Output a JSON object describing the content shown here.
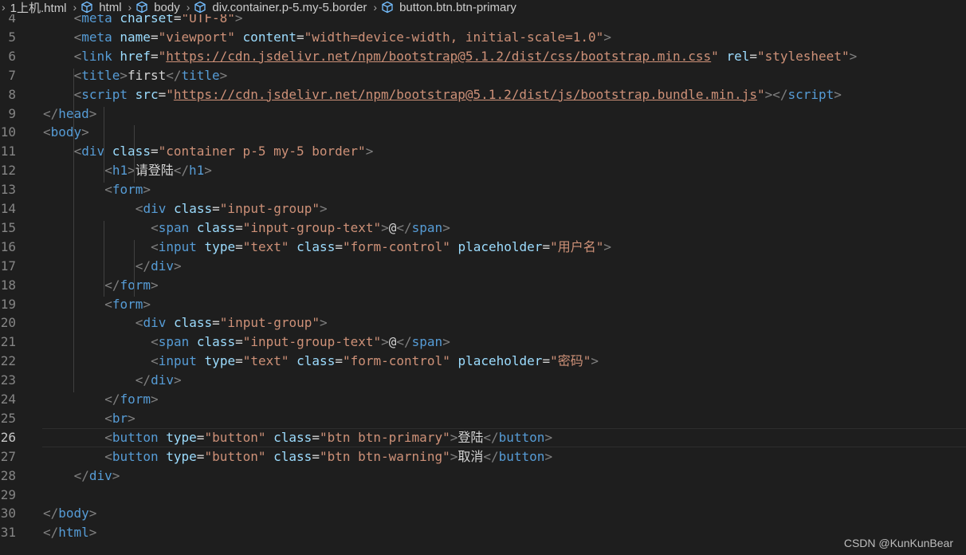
{
  "breadcrumb": {
    "items": [
      {
        "label": "1上机.html",
        "icon": "html-file-icon"
      },
      {
        "label": "html",
        "icon": "cube-icon"
      },
      {
        "label": "body",
        "icon": "cube-icon"
      },
      {
        "label": "div.container.p-5.my-5.border",
        "icon": "cube-icon"
      },
      {
        "label": "button.btn.btn-primary",
        "icon": "cube-icon"
      }
    ]
  },
  "editor": {
    "active_line": 26,
    "colors": {
      "background": "#1e1e1e",
      "tag": "#569cd6",
      "punctuation": "#808080",
      "attribute": "#9cdcfe",
      "string": "#ce9178",
      "text": "#d4d4d4"
    },
    "lines": [
      {
        "num": "4",
        "indent": 1,
        "tokens": [
          {
            "k": "p",
            "v": "<"
          },
          {
            "k": "t",
            "v": "meta"
          },
          {
            "k": "x",
            "v": " "
          },
          {
            "k": "a",
            "v": "charset"
          },
          {
            "k": "x",
            "v": "="
          },
          {
            "k": "s",
            "v": "\"UTF-8\""
          },
          {
            "k": "p",
            "v": ">"
          }
        ]
      },
      {
        "num": "5",
        "indent": 1,
        "tokens": [
          {
            "k": "p",
            "v": "<"
          },
          {
            "k": "t",
            "v": "meta"
          },
          {
            "k": "x",
            "v": " "
          },
          {
            "k": "a",
            "v": "name"
          },
          {
            "k": "x",
            "v": "="
          },
          {
            "k": "s",
            "v": "\"viewport\""
          },
          {
            "k": "x",
            "v": " "
          },
          {
            "k": "a",
            "v": "content"
          },
          {
            "k": "x",
            "v": "="
          },
          {
            "k": "s",
            "v": "\"width=device-width, initial-scale=1.0\""
          },
          {
            "k": "p",
            "v": ">"
          }
        ]
      },
      {
        "num": "6",
        "indent": 1,
        "tokens": [
          {
            "k": "p",
            "v": "<"
          },
          {
            "k": "t",
            "v": "link"
          },
          {
            "k": "x",
            "v": " "
          },
          {
            "k": "a",
            "v": "href"
          },
          {
            "k": "x",
            "v": "="
          },
          {
            "k": "s",
            "v": "\""
          },
          {
            "k": "su",
            "v": "https://cdn.jsdelivr.net/npm/bootstrap@5.1.2/dist/css/bootstrap.min.css"
          },
          {
            "k": "s",
            "v": "\""
          },
          {
            "k": "x",
            "v": " "
          },
          {
            "k": "a",
            "v": "rel"
          },
          {
            "k": "x",
            "v": "="
          },
          {
            "k": "s",
            "v": "\"stylesheet\""
          },
          {
            "k": "p",
            "v": ">"
          }
        ]
      },
      {
        "num": "7",
        "indent": 1,
        "tokens": [
          {
            "k": "p",
            "v": "<"
          },
          {
            "k": "t",
            "v": "title"
          },
          {
            "k": "p",
            "v": ">"
          },
          {
            "k": "x",
            "v": "first"
          },
          {
            "k": "p",
            "v": "</"
          },
          {
            "k": "t",
            "v": "title"
          },
          {
            "k": "p",
            "v": ">"
          }
        ]
      },
      {
        "num": "8",
        "indent": 1,
        "tokens": [
          {
            "k": "p",
            "v": "<"
          },
          {
            "k": "t",
            "v": "script"
          },
          {
            "k": "x",
            "v": " "
          },
          {
            "k": "a",
            "v": "src"
          },
          {
            "k": "x",
            "v": "="
          },
          {
            "k": "s",
            "v": "\""
          },
          {
            "k": "su",
            "v": "https://cdn.jsdelivr.net/npm/bootstrap@5.1.2/dist/js/bootstrap.bundle.min.js"
          },
          {
            "k": "s",
            "v": "\""
          },
          {
            "k": "p",
            "v": "></"
          },
          {
            "k": "t",
            "v": "script"
          },
          {
            "k": "p",
            "v": ">"
          }
        ]
      },
      {
        "num": "9",
        "indent": 0,
        "tokens": [
          {
            "k": "p",
            "v": "</"
          },
          {
            "k": "t",
            "v": "head"
          },
          {
            "k": "p",
            "v": ">"
          }
        ]
      },
      {
        "num": "10",
        "indent": 0,
        "tokens": [
          {
            "k": "p",
            "v": "<"
          },
          {
            "k": "t",
            "v": "body"
          },
          {
            "k": "p",
            "v": ">"
          }
        ]
      },
      {
        "num": "11",
        "indent": 1,
        "tokens": [
          {
            "k": "p",
            "v": "<"
          },
          {
            "k": "t",
            "v": "div"
          },
          {
            "k": "x",
            "v": " "
          },
          {
            "k": "a",
            "v": "class"
          },
          {
            "k": "x",
            "v": "="
          },
          {
            "k": "s",
            "v": "\"container p-5 my-5 border\""
          },
          {
            "k": "p",
            "v": ">"
          }
        ]
      },
      {
        "num": "12",
        "indent": 2,
        "tokens": [
          {
            "k": "p",
            "v": "<"
          },
          {
            "k": "t",
            "v": "h1"
          },
          {
            "k": "p",
            "v": ">"
          },
          {
            "k": "x",
            "v": "请登陆"
          },
          {
            "k": "p",
            "v": "</"
          },
          {
            "k": "t",
            "v": "h1"
          },
          {
            "k": "p",
            "v": ">"
          }
        ]
      },
      {
        "num": "13",
        "indent": 2,
        "tokens": [
          {
            "k": "p",
            "v": "<"
          },
          {
            "k": "t",
            "v": "form"
          },
          {
            "k": "p",
            "v": ">"
          }
        ]
      },
      {
        "num": "14",
        "indent": 3,
        "tokens": [
          {
            "k": "p",
            "v": "<"
          },
          {
            "k": "t",
            "v": "div"
          },
          {
            "k": "x",
            "v": " "
          },
          {
            "k": "a",
            "v": "class"
          },
          {
            "k": "x",
            "v": "="
          },
          {
            "k": "s",
            "v": "\"input-group\""
          },
          {
            "k": "p",
            "v": ">"
          }
        ]
      },
      {
        "num": "15",
        "indent": 3.5,
        "tokens": [
          {
            "k": "p",
            "v": "<"
          },
          {
            "k": "t",
            "v": "span"
          },
          {
            "k": "x",
            "v": " "
          },
          {
            "k": "a",
            "v": "class"
          },
          {
            "k": "x",
            "v": "="
          },
          {
            "k": "s",
            "v": "\"input-group-text\""
          },
          {
            "k": "p",
            "v": ">"
          },
          {
            "k": "x",
            "v": "@"
          },
          {
            "k": "p",
            "v": "</"
          },
          {
            "k": "t",
            "v": "span"
          },
          {
            "k": "p",
            "v": ">"
          }
        ]
      },
      {
        "num": "16",
        "indent": 3.5,
        "tokens": [
          {
            "k": "p",
            "v": "<"
          },
          {
            "k": "t",
            "v": "input"
          },
          {
            "k": "x",
            "v": " "
          },
          {
            "k": "a",
            "v": "type"
          },
          {
            "k": "x",
            "v": "="
          },
          {
            "k": "s",
            "v": "\"text\""
          },
          {
            "k": "x",
            "v": " "
          },
          {
            "k": "a",
            "v": "class"
          },
          {
            "k": "x",
            "v": "="
          },
          {
            "k": "s",
            "v": "\"form-control\""
          },
          {
            "k": "x",
            "v": " "
          },
          {
            "k": "a",
            "v": "placeholder"
          },
          {
            "k": "x",
            "v": "="
          },
          {
            "k": "s",
            "v": "\"用户名\""
          },
          {
            "k": "p",
            "v": ">"
          }
        ]
      },
      {
        "num": "17",
        "indent": 3,
        "tokens": [
          {
            "k": "p",
            "v": "</"
          },
          {
            "k": "t",
            "v": "div"
          },
          {
            "k": "p",
            "v": ">"
          }
        ]
      },
      {
        "num": "18",
        "indent": 2,
        "tokens": [
          {
            "k": "p",
            "v": "</"
          },
          {
            "k": "t",
            "v": "form"
          },
          {
            "k": "p",
            "v": ">"
          }
        ]
      },
      {
        "num": "19",
        "indent": 2,
        "tokens": [
          {
            "k": "p",
            "v": "<"
          },
          {
            "k": "t",
            "v": "form"
          },
          {
            "k": "p",
            "v": ">"
          }
        ]
      },
      {
        "num": "20",
        "indent": 3,
        "tokens": [
          {
            "k": "p",
            "v": "<"
          },
          {
            "k": "t",
            "v": "div"
          },
          {
            "k": "x",
            "v": " "
          },
          {
            "k": "a",
            "v": "class"
          },
          {
            "k": "x",
            "v": "="
          },
          {
            "k": "s",
            "v": "\"input-group\""
          },
          {
            "k": "p",
            "v": ">"
          }
        ]
      },
      {
        "num": "21",
        "indent": 3.5,
        "tokens": [
          {
            "k": "p",
            "v": "<"
          },
          {
            "k": "t",
            "v": "span"
          },
          {
            "k": "x",
            "v": " "
          },
          {
            "k": "a",
            "v": "class"
          },
          {
            "k": "x",
            "v": "="
          },
          {
            "k": "s",
            "v": "\"input-group-text\""
          },
          {
            "k": "p",
            "v": ">"
          },
          {
            "k": "x",
            "v": "@"
          },
          {
            "k": "p",
            "v": "</"
          },
          {
            "k": "t",
            "v": "span"
          },
          {
            "k": "p",
            "v": ">"
          }
        ]
      },
      {
        "num": "22",
        "indent": 3.5,
        "tokens": [
          {
            "k": "p",
            "v": "<"
          },
          {
            "k": "t",
            "v": "input"
          },
          {
            "k": "x",
            "v": " "
          },
          {
            "k": "a",
            "v": "type"
          },
          {
            "k": "x",
            "v": "="
          },
          {
            "k": "s",
            "v": "\"text\""
          },
          {
            "k": "x",
            "v": " "
          },
          {
            "k": "a",
            "v": "class"
          },
          {
            "k": "x",
            "v": "="
          },
          {
            "k": "s",
            "v": "\"form-control\""
          },
          {
            "k": "x",
            "v": " "
          },
          {
            "k": "a",
            "v": "placeholder"
          },
          {
            "k": "x",
            "v": "="
          },
          {
            "k": "s",
            "v": "\"密码\""
          },
          {
            "k": "p",
            "v": ">"
          }
        ]
      },
      {
        "num": "23",
        "indent": 3,
        "tokens": [
          {
            "k": "p",
            "v": "</"
          },
          {
            "k": "t",
            "v": "div"
          },
          {
            "k": "p",
            "v": ">"
          }
        ]
      },
      {
        "num": "24",
        "indent": 2,
        "tokens": [
          {
            "k": "p",
            "v": "</"
          },
          {
            "k": "t",
            "v": "form"
          },
          {
            "k": "p",
            "v": ">"
          }
        ]
      },
      {
        "num": "25",
        "indent": 2,
        "tokens": [
          {
            "k": "p",
            "v": "<"
          },
          {
            "k": "t",
            "v": "br"
          },
          {
            "k": "p",
            "v": ">"
          }
        ]
      },
      {
        "num": "26",
        "indent": 2,
        "tokens": [
          {
            "k": "p",
            "v": "<"
          },
          {
            "k": "t",
            "v": "button"
          },
          {
            "k": "x",
            "v": " "
          },
          {
            "k": "a",
            "v": "type"
          },
          {
            "k": "x",
            "v": "="
          },
          {
            "k": "s",
            "v": "\"button\""
          },
          {
            "k": "x",
            "v": " "
          },
          {
            "k": "a",
            "v": "class"
          },
          {
            "k": "x",
            "v": "="
          },
          {
            "k": "s",
            "v": "\"btn btn-primary\""
          },
          {
            "k": "p",
            "v": ">"
          },
          {
            "k": "x",
            "v": "登陆"
          },
          {
            "k": "p",
            "v": "</"
          },
          {
            "k": "t",
            "v": "button"
          },
          {
            "k": "p",
            "v": ">"
          }
        ]
      },
      {
        "num": "27",
        "indent": 2,
        "tokens": [
          {
            "k": "p",
            "v": "<"
          },
          {
            "k": "t",
            "v": "button"
          },
          {
            "k": "x",
            "v": " "
          },
          {
            "k": "a",
            "v": "type"
          },
          {
            "k": "x",
            "v": "="
          },
          {
            "k": "s",
            "v": "\"button\""
          },
          {
            "k": "x",
            "v": " "
          },
          {
            "k": "a",
            "v": "class"
          },
          {
            "k": "x",
            "v": "="
          },
          {
            "k": "s",
            "v": "\"btn btn-warning\""
          },
          {
            "k": "p",
            "v": ">"
          },
          {
            "k": "x",
            "v": "取消"
          },
          {
            "k": "p",
            "v": "</"
          },
          {
            "k": "t",
            "v": "button"
          },
          {
            "k": "p",
            "v": ">"
          }
        ]
      },
      {
        "num": "28",
        "indent": 1,
        "tokens": [
          {
            "k": "p",
            "v": "</"
          },
          {
            "k": "t",
            "v": "div"
          },
          {
            "k": "p",
            "v": ">"
          }
        ]
      },
      {
        "num": "29",
        "indent": 0,
        "tokens": []
      },
      {
        "num": "30",
        "indent": 0,
        "tokens": [
          {
            "k": "p",
            "v": "</"
          },
          {
            "k": "t",
            "v": "body"
          },
          {
            "k": "p",
            "v": ">"
          }
        ]
      },
      {
        "num": "31",
        "indent": 0,
        "tokens": [
          {
            "k": "p",
            "v": "</"
          },
          {
            "k": "t",
            "v": "html"
          },
          {
            "k": "p",
            "v": ">"
          }
        ]
      }
    ]
  },
  "watermark": "CSDN @KunKunBear"
}
